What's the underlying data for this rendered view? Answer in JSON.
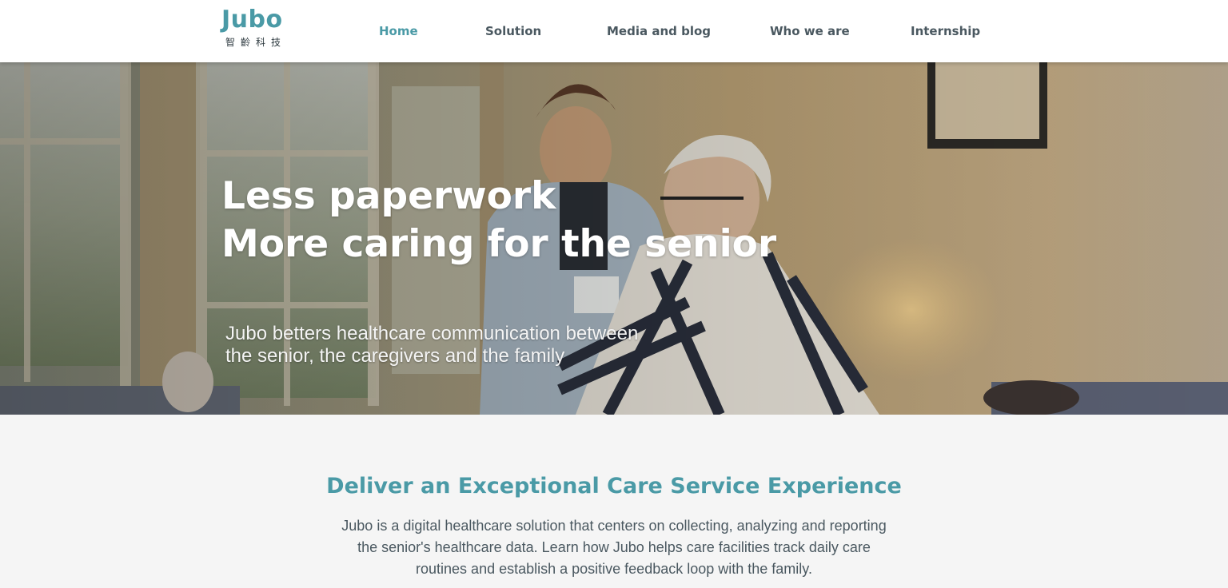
{
  "logo": {
    "wordmark": "Jubo",
    "subtitle": "智齡科技"
  },
  "nav": {
    "items": [
      {
        "label": "Home",
        "active": true
      },
      {
        "label": "Solution",
        "active": false
      },
      {
        "label": "Media and blog",
        "active": false
      },
      {
        "label": "Who we are",
        "active": false
      },
      {
        "label": "Internship",
        "active": false
      }
    ]
  },
  "hero": {
    "title_lines": [
      "Less paperwork",
      "More caring for the senior"
    ],
    "subtitle_lines": [
      "Jubo betters healthcare communication between",
      "the senior, the caregivers and the family"
    ]
  },
  "intro": {
    "heading": "Deliver an Exceptional Care Service Experience",
    "body_lines": [
      "Jubo is a digital healthcare solution that centers on collecting, analyzing and reporting",
      "the senior's healthcare data. Learn how Jubo helps care facilities track daily care",
      "routines and establish a positive feedback loop with the family."
    ]
  },
  "colors": {
    "brand_teal": "#4a9aa6",
    "nav_text": "#4a5860",
    "section_bg": "#f5f5f5"
  }
}
